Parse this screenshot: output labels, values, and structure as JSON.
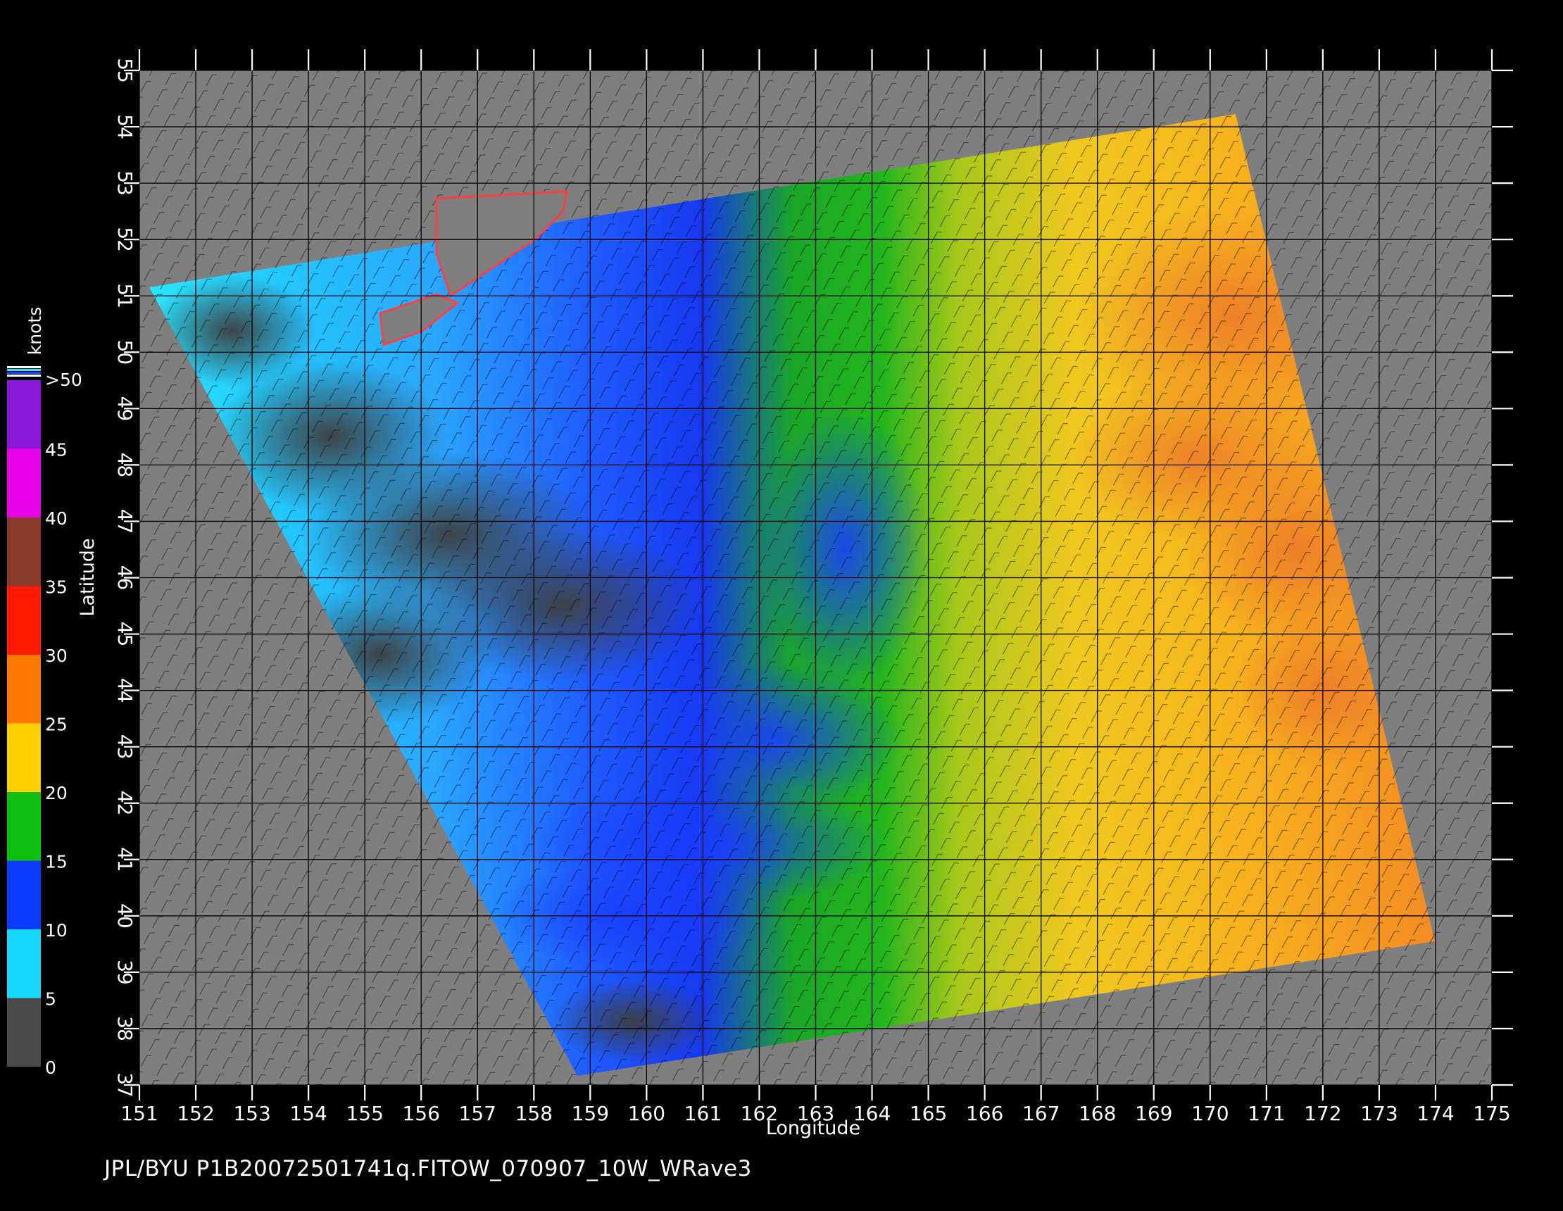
{
  "map": {
    "x_axis_title": "Longitude",
    "y_axis_title": "Latitude",
    "lon_ticks": [
      "151",
      "152",
      "153",
      "154",
      "155",
      "156",
      "157",
      "158",
      "159",
      "160",
      "161",
      "162",
      "163",
      "164",
      "165",
      "166",
      "167",
      "168",
      "169",
      "170",
      "171",
      "172",
      "173",
      "174",
      "175"
    ],
    "lat_ticks": [
      "37",
      "38",
      "39",
      "40",
      "41",
      "42",
      "43",
      "44",
      "45",
      "46",
      "47",
      "48",
      "49",
      "50",
      "51",
      "52",
      "53",
      "54",
      "55"
    ],
    "lon_range": [
      151,
      175
    ],
    "lat_range": [
      37,
      55
    ],
    "background_color": "#000000",
    "land_color": "#7f7f7f",
    "grid_color": "#000000"
  },
  "colorbar": {
    "title": "knots",
    "labels": [
      "0",
      "5",
      "10",
      "15",
      "20",
      "25",
      "30",
      "35",
      "40",
      "45",
      ">50"
    ],
    "bands": [
      {
        "from": 0,
        "to": 5,
        "color": "#4a4a4a"
      },
      {
        "from": 5,
        "to": 10,
        "color": "#17d9ff"
      },
      {
        "from": 10,
        "to": 15,
        "color": "#0a3cff"
      },
      {
        "from": 15,
        "to": 20,
        "color": "#10c010"
      },
      {
        "from": 20,
        "to": 25,
        "color": "#ffd000"
      },
      {
        "from": 25,
        "to": 30,
        "color": "#ff7a00"
      },
      {
        "from": 30,
        "to": 35,
        "color": "#ff1a00"
      },
      {
        "from": 35,
        "to": 40,
        "color": "#8a3a2a"
      },
      {
        "from": 40,
        "to": 45,
        "color": "#e800e8"
      },
      {
        "from": 45,
        "to": 50,
        "color": "#8a18d8"
      }
    ]
  },
  "caption": "JPL/BYU  P1B20072501741q.FITOW_070907_10W_WRave3"
}
